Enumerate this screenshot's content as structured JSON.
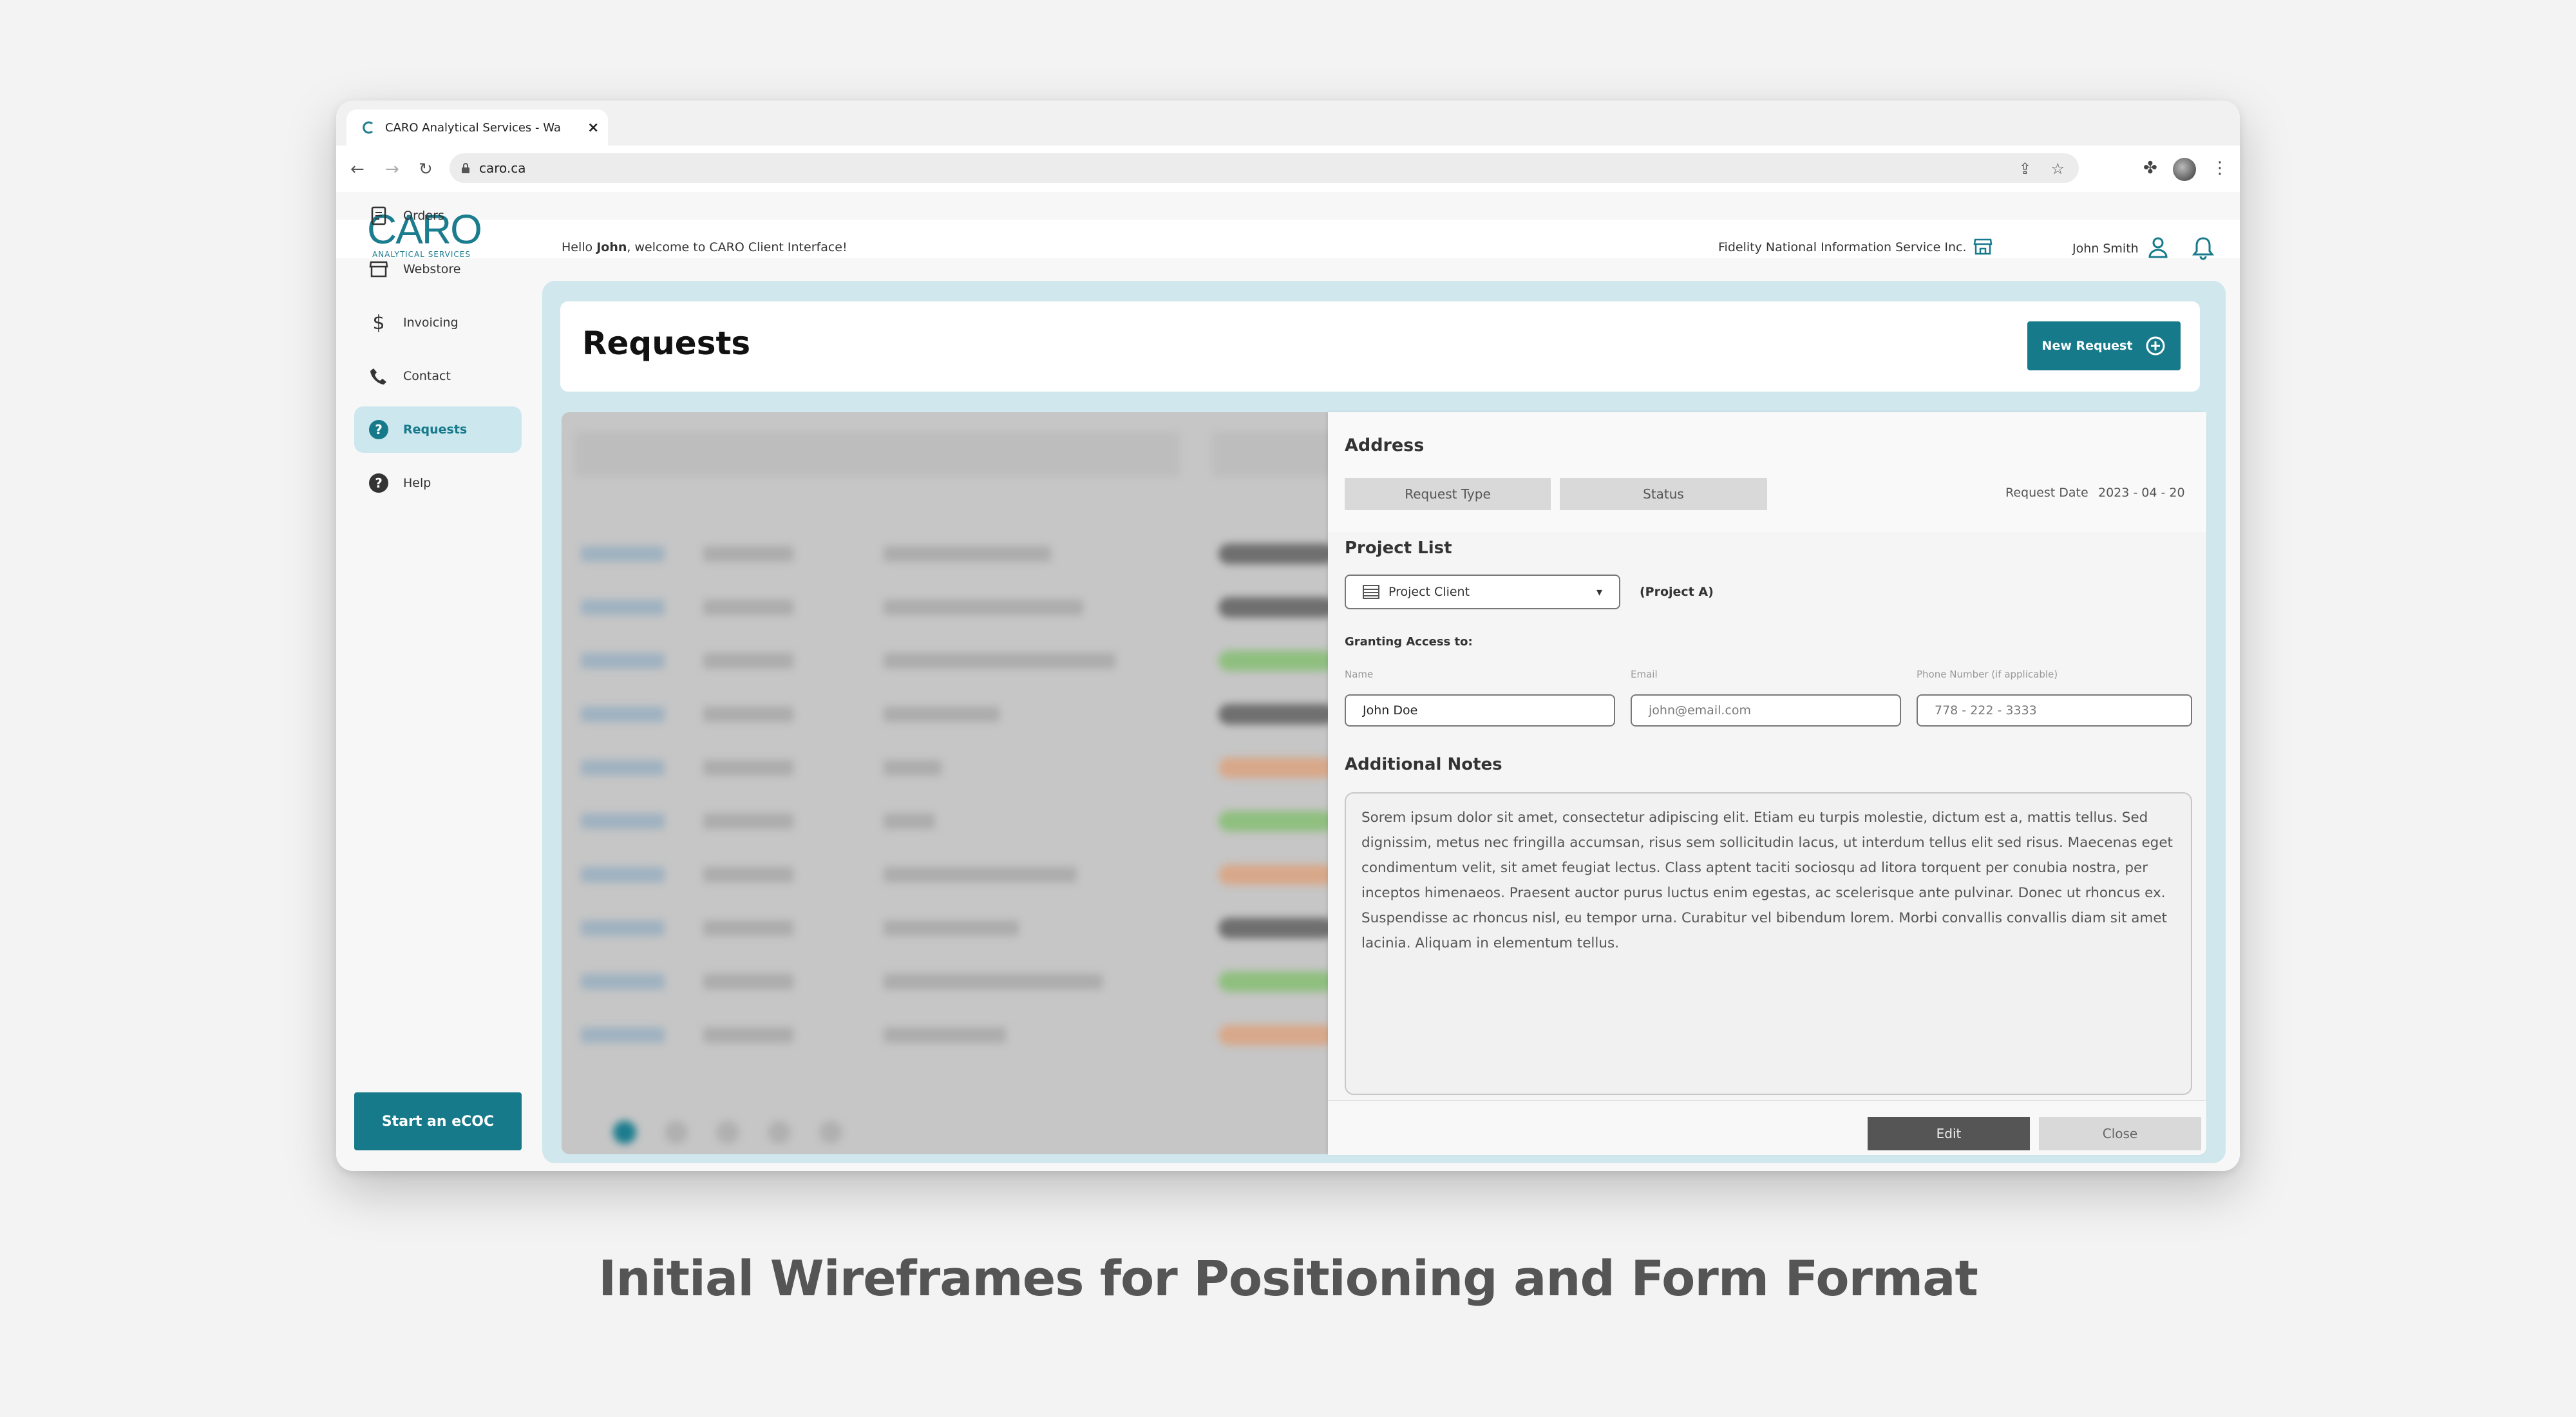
{
  "browser": {
    "tab_title": "CARO Analytical Services - Wa",
    "url": "caro.ca"
  },
  "header": {
    "logo_text": "CARO",
    "logo_sub": "ANALYTICAL SERVICES",
    "greeting_prefix": "Hello ",
    "greeting_name": "John",
    "greeting_suffix": ", welcome to CARO Client Interface!",
    "company": "Fidelity National Information Service Inc.",
    "user_name": "John Smith"
  },
  "sidebar": {
    "items": [
      {
        "label": "Orders",
        "icon": "document-icon"
      },
      {
        "label": "Webstore",
        "icon": "store-icon"
      },
      {
        "label": "Invoicing",
        "icon": "dollar-icon"
      },
      {
        "label": "Contact",
        "icon": "phone-icon"
      },
      {
        "label": "Requests",
        "icon": "question-circle-icon",
        "active": true
      },
      {
        "label": "Help",
        "icon": "help-circle-icon"
      }
    ],
    "start_button": "Start an eCOC"
  },
  "page": {
    "title": "Requests",
    "new_request_label": "New Request"
  },
  "detail": {
    "title": "Address",
    "request_type_label": "Request Type",
    "status_label": "Status",
    "request_date_label": "Request Date",
    "request_date_value": "2023 - 04 - 20",
    "project_list_heading": "Project List",
    "project_select_value": "Project Client",
    "project_tag": "(Project A)",
    "granting_heading": "Granting Access to:",
    "name_label": "Name",
    "email_label": "Email",
    "phone_label": "Phone Number (if applicable)",
    "name_value": "John Doe",
    "email_value": "john@email.com",
    "phone_value": "778 - 222 - 3333",
    "notes_heading": "Additional Notes",
    "notes_text": "Sorem ipsum dolor sit amet, consectetur adipiscing elit. Etiam eu turpis molestie, dictum est a, mattis tellus. Sed dignissim, metus nec fringilla accumsan, risus sem sollicitudin lacus, ut interdum tellus elit sed risus. Maecenas eget condimentum velit, sit amet feugiat lectus. Class aptent taciti sociosqu ad litora torquent per conubia nostra, per inceptos himenaeos. Praesent auctor purus luctus enim egestas, ac scelerisque ante pulvinar. Donec ut rhoncus ex. Suspendisse ac rhoncus nisl, eu tempor urna. Curabitur vel bibendum lorem. Morbi convallis convallis diam sit amet lacinia. Aliquam in elementum tellus.",
    "edit_label": "Edit",
    "close_label": "Close"
  },
  "caption": "Initial Wireframes for Positioning and Form Format",
  "colors": {
    "accent": "#167a8a",
    "panel_bg": "#cfe7ed",
    "active_nav_bg": "#cde7ef"
  }
}
